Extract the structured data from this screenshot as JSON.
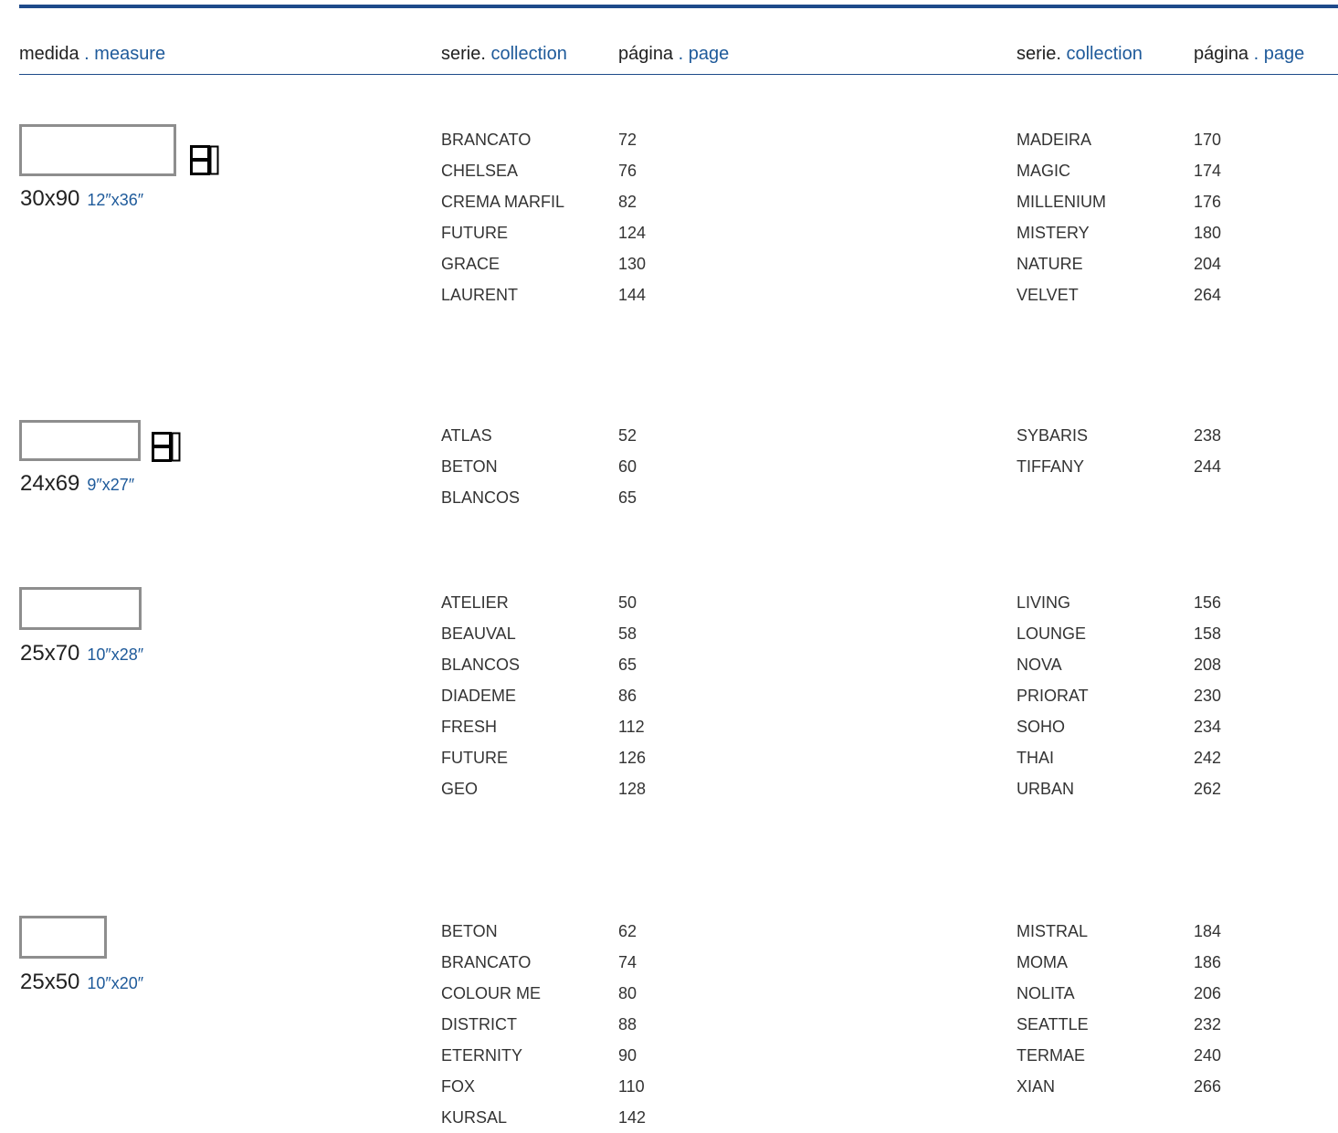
{
  "colors": {
    "accent": "#1e4a8a",
    "tile_border": "#8e8e8e"
  },
  "header": {
    "measure_es": "medida",
    "measure_sep": " . ",
    "measure_en": "measure",
    "collection_es": "serie.",
    "collection_en": "collection",
    "page_es": "página",
    "page_sep": " . ",
    "page_en": "page"
  },
  "sections": [
    {
      "size_cm": "30x90",
      "size_in": "12″x36″",
      "icon": "tile-format-icon",
      "left": [
        {
          "collection": "BRANCATO",
          "page": "72"
        },
        {
          "collection": "CHELSEA",
          "page": "76"
        },
        {
          "collection": "CREMA MARFIL",
          "page": "82"
        },
        {
          "collection": "FUTURE",
          "page": "124"
        },
        {
          "collection": "GRACE",
          "page": "130"
        },
        {
          "collection": "LAURENT",
          "page": "144"
        }
      ],
      "right": [
        {
          "collection": "MADEIRA",
          "page": "170"
        },
        {
          "collection": "MAGIC",
          "page": "174"
        },
        {
          "collection": "MILLENIUM",
          "page": "176"
        },
        {
          "collection": "MISTERY",
          "page": "180"
        },
        {
          "collection": "NATURE",
          "page": "204"
        },
        {
          "collection": "VELVET",
          "page": "264"
        }
      ]
    },
    {
      "size_cm": "24x69",
      "size_in": "9″x27″",
      "icon": "tile-format-icon",
      "left": [
        {
          "collection": "ATLAS",
          "page": "52"
        },
        {
          "collection": "BETON",
          "page": "60"
        },
        {
          "collection": "BLANCOS",
          "page": "65"
        }
      ],
      "right": [
        {
          "collection": "SYBARIS",
          "page": "238"
        },
        {
          "collection": "TIFFANY",
          "page": "244"
        }
      ]
    },
    {
      "size_cm": "25x70",
      "size_in": "10″x28″",
      "left": [
        {
          "collection": "ATELIER",
          "page": "50"
        },
        {
          "collection": "BEAUVAL",
          "page": "58"
        },
        {
          "collection": "BLANCOS",
          "page": "65"
        },
        {
          "collection": "DIADEME",
          "page": "86"
        },
        {
          "collection": "FRESH",
          "page": "112"
        },
        {
          "collection": "FUTURE",
          "page": "126"
        },
        {
          "collection": "GEO",
          "page": "128"
        }
      ],
      "right": [
        {
          "collection": "LIVING",
          "page": "156"
        },
        {
          "collection": "LOUNGE",
          "page": "158"
        },
        {
          "collection": "NOVA",
          "page": "208"
        },
        {
          "collection": "PRIORAT",
          "page": "230"
        },
        {
          "collection": "SOHO",
          "page": "234"
        },
        {
          "collection": "THAI",
          "page": "242"
        },
        {
          "collection": "URBAN",
          "page": "262"
        }
      ]
    },
    {
      "size_cm": "25x50",
      "size_in": "10″x20″",
      "left": [
        {
          "collection": "BETON",
          "page": "62"
        },
        {
          "collection": "BRANCATO",
          "page": "74"
        },
        {
          "collection": "COLOUR ME",
          "page": "80"
        },
        {
          "collection": "DISTRICT",
          "page": "88"
        },
        {
          "collection": "ETERNITY",
          "page": "90"
        },
        {
          "collection": "FOX",
          "page": "110"
        },
        {
          "collection": "KURSAL",
          "page": "142"
        }
      ],
      "right": [
        {
          "collection": "MISTRAL",
          "page": "184"
        },
        {
          "collection": "MOMA",
          "page": "186"
        },
        {
          "collection": "NOLITA",
          "page": "206"
        },
        {
          "collection": "SEATTLE",
          "page": "232"
        },
        {
          "collection": "TERMAE",
          "page": "240"
        },
        {
          "collection": "XIAN",
          "page": "266"
        }
      ]
    }
  ]
}
